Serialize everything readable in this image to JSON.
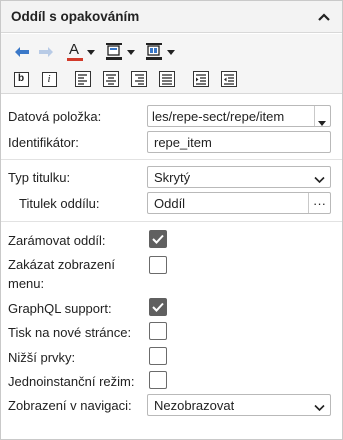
{
  "panel": {
    "title": "Oddíl s opakováním"
  },
  "toolbar": {
    "icons": [
      "arrow-left-icon",
      "arrow-right-icon",
      "font-color-icon",
      "background-color-icon",
      "border-color-icon",
      "bold-icon",
      "italic-icon",
      "align-left-icon",
      "align-center-icon",
      "align-right-icon",
      "align-justify-icon",
      "indent-icon",
      "outdent-icon"
    ],
    "bold_glyph": "b",
    "italic_glyph": "i",
    "font_color_glyph": "A"
  },
  "fields": {
    "data_item": {
      "label": "Datová položka:",
      "value": "les/repe-sect/repe/item"
    },
    "identifier": {
      "label": "Identifikátor:",
      "value": "repe_item"
    },
    "title_type": {
      "label": "Typ titulku:",
      "value": "Skrytý"
    },
    "section_title": {
      "label": "Titulek oddílu:",
      "value": "Oddíl",
      "more": "···"
    },
    "frame_section": {
      "label": "Zarámovat oddíl:",
      "checked": true
    },
    "hide_menu": {
      "label_line1": "Zakázat zobrazení",
      "label_line2": "menu:",
      "checked": false
    },
    "graphql": {
      "label": "GraphQL support:",
      "checked": true
    },
    "print_new_page": {
      "label": "Tisk na nové stránce:",
      "checked": false
    },
    "lower_items": {
      "label": "Nižší prvky:",
      "checked": false
    },
    "single_instance": {
      "label": "Jednoinstanční režim:",
      "checked": false
    },
    "nav_display": {
      "label": "Zobrazení v navigaci:",
      "value": "Nezobrazovat"
    }
  },
  "colors": {
    "accent_blue": "#3a78c8",
    "font_red": "#d23a2a",
    "checkbox_fill": "#606060"
  }
}
